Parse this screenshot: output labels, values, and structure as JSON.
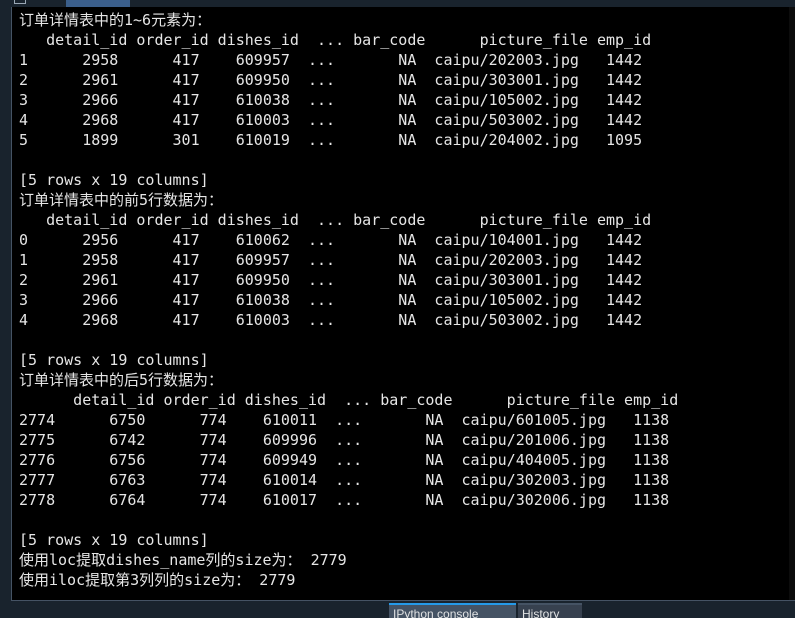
{
  "console": {
    "lines": [
      "订单详情表中的1~6元素为：",
      "   detail_id order_id dishes_id  ... bar_code      picture_file emp_id",
      "1      2958      417    609957  ...       NA  caipu/202003.jpg   1442",
      "2      2961      417    609950  ...       NA  caipu/303001.jpg   1442",
      "3      2966      417    610038  ...       NA  caipu/105002.jpg   1442",
      "4      2968      417    610003  ...       NA  caipu/503002.jpg   1442",
      "5      1899      301    610019  ...       NA  caipu/204002.jpg   1095",
      "",
      "[5 rows x 19 columns]",
      "订单详情表中的前5行数据为：",
      "   detail_id order_id dishes_id  ... bar_code      picture_file emp_id",
      "0      2956      417    610062  ...       NA  caipu/104001.jpg   1442",
      "1      2958      417    609957  ...       NA  caipu/202003.jpg   1442",
      "2      2961      417    609950  ...       NA  caipu/303001.jpg   1442",
      "3      2966      417    610038  ...       NA  caipu/105002.jpg   1442",
      "4      2968      417    610003  ...       NA  caipu/503002.jpg   1442",
      "",
      "[5 rows x 19 columns]",
      "订单详情表中的后5行数据为：",
      "      detail_id order_id dishes_id  ... bar_code      picture_file emp_id",
      "2774      6750      774    610011  ...       NA  caipu/601005.jpg   1138",
      "2775      6742      774    609996  ...       NA  caipu/201006.jpg   1138",
      "2776      6756      774    609949  ...       NA  caipu/404005.jpg   1138",
      "2777      6763      774    610014  ...       NA  caipu/302003.jpg   1138",
      "2778      6764      774    610017  ...       NA  caipu/302006.jpg   1138",
      "",
      "[5 rows x 19 columns]",
      "使用loc提取dishes_name列的size为： 2779",
      "使用iloc提取第3列列的size为： 2779"
    ]
  },
  "tabs": {
    "ipython_console": "IPython console",
    "history": "History"
  }
}
